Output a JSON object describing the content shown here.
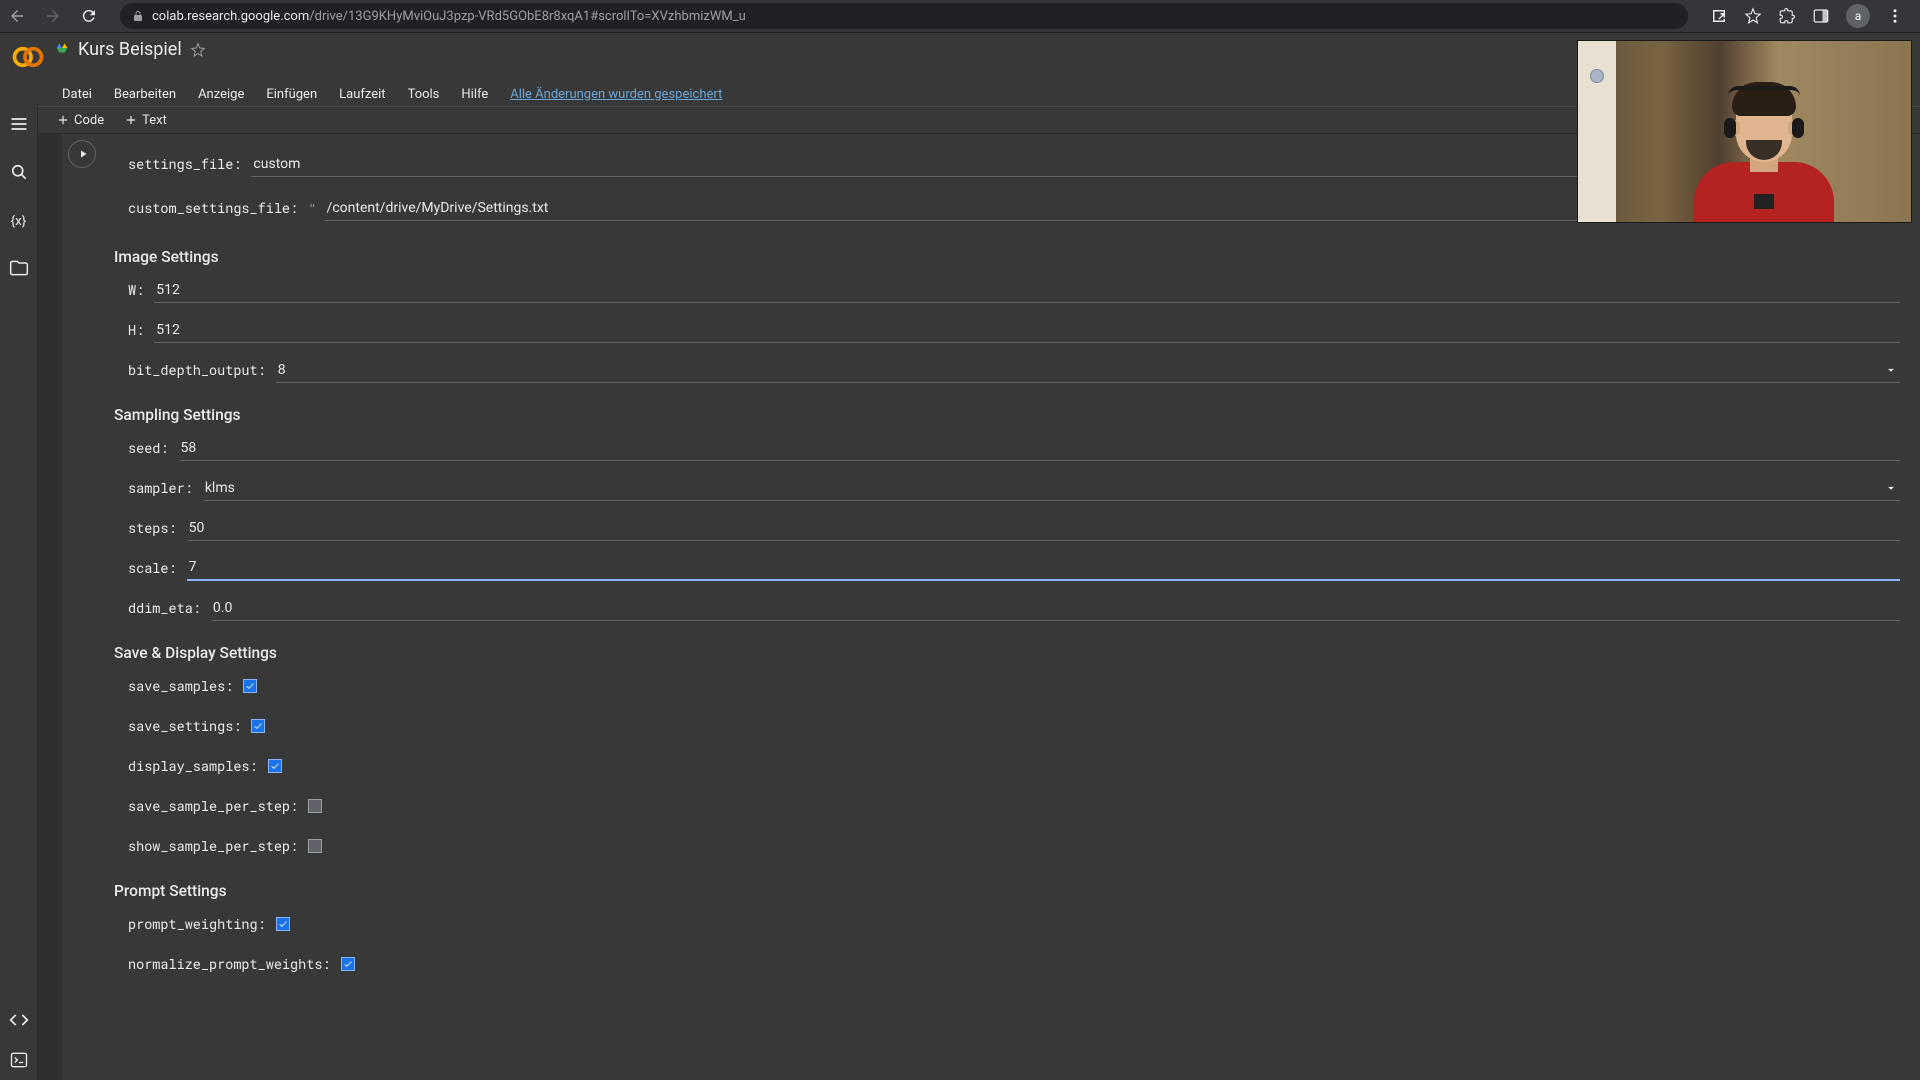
{
  "url_host": "colab.research.google.com",
  "url_path": "/drive/13G9KHyMviOuJ3pzp-VRd5GObE8r8xqA1#scrollTo=XVzhbmizWM_u",
  "avatar_letter": "a",
  "notebook_title": "Kurs Beispiel",
  "menu": [
    "Datei",
    "Bearbeiten",
    "Anzeige",
    "Einfügen",
    "Laufzeit",
    "Tools",
    "Hilfe"
  ],
  "save_status": "Alle Änderungen wurden gespeichert",
  "toolbar": {
    "code": "Code",
    "text": "Text"
  },
  "form": {
    "settings_file_label": "settings_file:",
    "settings_file_value": "custom",
    "custom_settings_file_label": "custom_settings_file:",
    "custom_settings_file_value": "/content/drive/MyDrive/Settings.txt",
    "image_settings_header": "Image Settings",
    "W_label": "W:",
    "W_value": "512",
    "H_label": "H:",
    "H_value": "512",
    "bit_depth_label": "bit_depth_output:",
    "bit_depth_value": "8",
    "sampling_header": "Sampling Settings",
    "seed_label": "seed:",
    "seed_value": "58",
    "sampler_label": "sampler:",
    "sampler_value": "klms",
    "steps_label": "steps:",
    "steps_value": "50",
    "scale_label": "scale:",
    "scale_value": "7",
    "ddim_eta_label": "ddim_eta:",
    "ddim_eta_value": "0.0",
    "save_display_header": "Save & Display Settings",
    "save_samples_label": "save_samples:",
    "save_settings_label": "save_settings:",
    "display_samples_label": "display_samples:",
    "save_sample_per_step_label": "save_sample_per_step:",
    "show_sample_per_step_label": "show_sample_per_step:",
    "prompt_header": "Prompt Settings",
    "prompt_weighting_label": "prompt_weighting:",
    "normalize_prompt_weights_label": "normalize_prompt_weights:"
  }
}
